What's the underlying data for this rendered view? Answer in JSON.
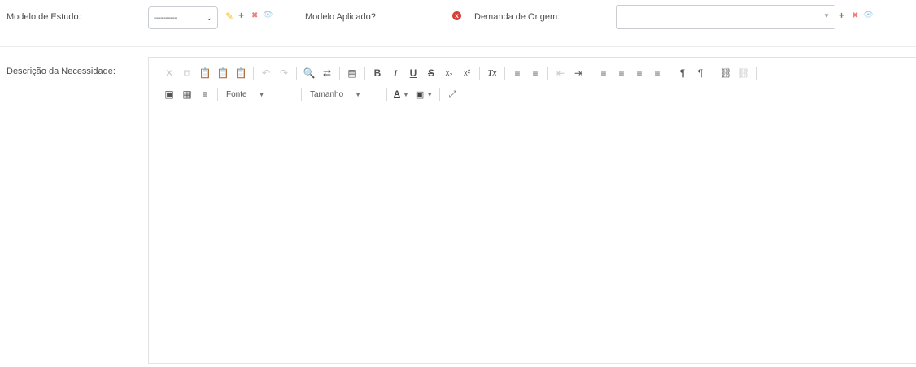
{
  "form": {
    "modelo_estudo_label": "Modelo de Estudo:",
    "modelo_estudo_value": "----------",
    "modelo_aplicado_label": "Modelo Aplicado?:",
    "demanda_origem_label": "Demanda de Origem:",
    "demanda_origem_value": "",
    "descricao_label": "Descrição da Necessidade:"
  },
  "icons": {
    "chevron": "⌄",
    "pencil": "✎",
    "plus": "+",
    "remove": "✖",
    "view": "👁",
    "error_x": "x",
    "caret": "▼"
  },
  "colors": {
    "pencil": "#f1c232",
    "plus": "#3fae29",
    "remove": "#f08080",
    "view": "#9fcbe8",
    "error": "#d9403a"
  },
  "editor": {
    "font_combo_label": "Fonte",
    "size_combo_label": "Tamanho",
    "font_color_label": "A",
    "bg_color_label": "▣",
    "content": ""
  },
  "toolbar_glyphs": {
    "cut": "✕",
    "copy": "⧉",
    "paste": "📋",
    "paste_text": "📋",
    "paste_word": "📋",
    "undo": "↶",
    "redo": "↷",
    "find": "🔍",
    "replace": "⇄",
    "select_all": "▤",
    "bold": "B",
    "italic": "I",
    "underline": "U",
    "strike": "S",
    "subscript": "x₂",
    "superscript": "x²",
    "remove_format": "Tx",
    "numbered_list": "≡",
    "bulleted_list": "≡",
    "outdent": "⇤",
    "indent": "⇥",
    "align_left": "≡",
    "align_center": "≡",
    "align_right": "≡",
    "justify": "≡",
    "ltr": "¶",
    "rtl": "¶",
    "link": "⛓",
    "unlink": "⛓",
    "image": "▣",
    "table": "▦",
    "hr": "≡",
    "maximize": "⤢"
  }
}
